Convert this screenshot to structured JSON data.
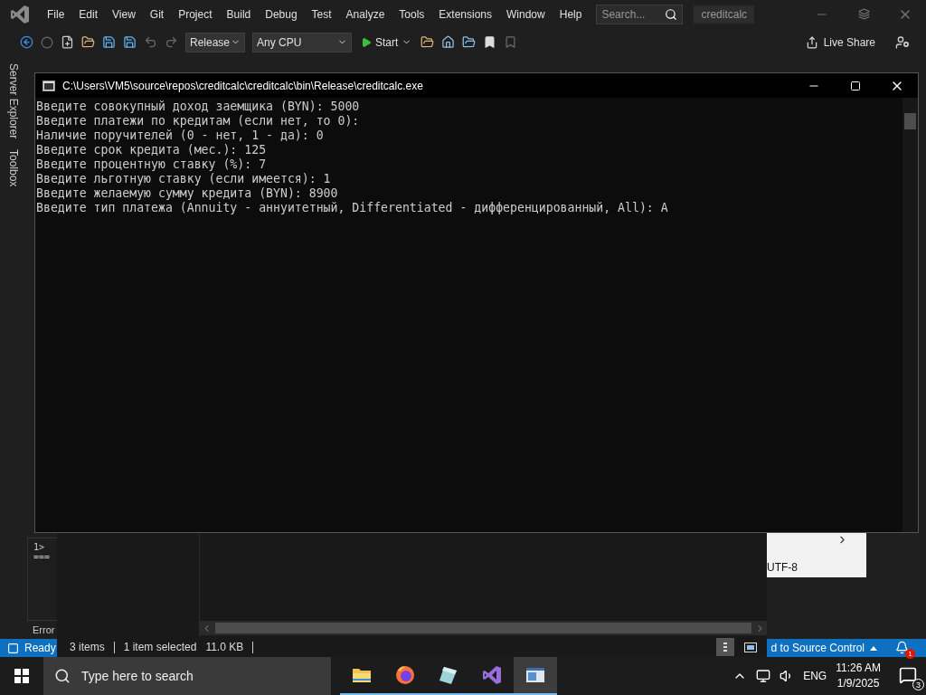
{
  "ide": {
    "menu": [
      "File",
      "Edit",
      "View",
      "Git",
      "Project",
      "Build",
      "Debug",
      "Test",
      "Analyze",
      "Tools",
      "Extensions",
      "Window",
      "Help"
    ],
    "search": {
      "placeholder": "Search..."
    },
    "solution_name": "creditcalc",
    "toolbar": {
      "configuration": "Release",
      "platform": "Any CPU",
      "start": "Start",
      "live_share": "Live Share"
    },
    "side_tabs": [
      "Server Explorer",
      "Toolbox"
    ],
    "output_lines": [
      "1>",
      "==="
    ],
    "output_tab": "Error",
    "status_bar": {
      "state": "Ready",
      "source_control": "d to Source Control",
      "notifications": "1"
    }
  },
  "console": {
    "title": "C:\\Users\\VM5\\source\\repos\\creditcalc\\creditcalc\\bin\\Release\\creditcalc.exe",
    "lines": [
      "Введите совокупный доход заемщика (BYN): 5000",
      "Введите платежи по кредитам (если нет, то 0):",
      "Наличие поручителей (0 - нет, 1 - да): 0",
      "Введите срок кредита (мес.): 125",
      "Введите процентную ставку (%): 7",
      "Введите льготную ставку (если имеется): 1",
      "Введите желаемую сумму кредита (BYN): 8900",
      "Введите тип платежа (Annuity - аннуитетный, Differentiated - дифференцированный, All): A"
    ]
  },
  "explorer": {
    "item_count": "3 items",
    "selection": "1 item selected",
    "size": "11.0 KB"
  },
  "popup": {
    "encoding": "UTF-8"
  },
  "taskbar": {
    "search_placeholder": "Type here to search",
    "apps": [
      {
        "kind": "folder",
        "selected": false
      },
      {
        "kind": "browser",
        "selected": false
      },
      {
        "kind": "notepad",
        "selected": false
      },
      {
        "kind": "studio",
        "selected": false
      },
      {
        "kind": "console",
        "selected": true
      }
    ],
    "language": "ENG",
    "time": "11:26 AM",
    "date": "1/9/2025",
    "notifications": "3"
  }
}
